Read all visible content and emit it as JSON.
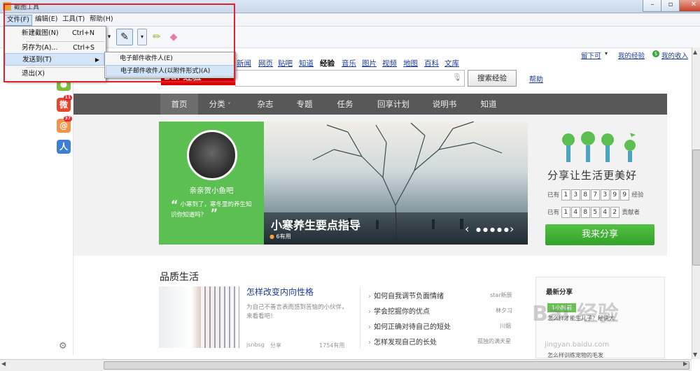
{
  "window": {
    "title": "截图工具"
  },
  "menubar": {
    "file": "文件(F)",
    "edit": "编辑(E)",
    "tools": "工具(T)",
    "help": "帮助(H)"
  },
  "file_menu": {
    "new_capture": "新建截图(N)",
    "new_capture_shortcut": "Ctrl+N",
    "save_as": "另存为(A)...",
    "save_as_shortcut": "Ctrl+S",
    "send_to": "发送到(T)",
    "exit": "退出(X)"
  },
  "send_to_menu": {
    "email_recipient": "电子邮件收件人(E)",
    "email_attachment": "电子邮件收件人(以附件形式)(A)"
  },
  "browser": {
    "top_nav": [
      "新闻",
      "网页",
      "贴吧",
      "知道",
      "经验",
      "音乐",
      "图片",
      "视频",
      "地图",
      "百科",
      "文库"
    ],
    "active_nav": "经验",
    "logo_text": "Bai 经验",
    "search_button": "搜索经验",
    "help_link": "帮助",
    "user_link": "留下可",
    "my_experience": "我的经验",
    "my_favorites": "我的收入",
    "side_badges": {
      "weibo": "11",
      "other": "37"
    },
    "categories": [
      "首页",
      "分类",
      "杂志",
      "专题",
      "任务",
      "回享计划",
      "说明书",
      "知道"
    ],
    "category_dropdown": "˅",
    "hero": {
      "user_name": "亲亲贺小鱼吧",
      "quote": "小寒到了，寒冬里的养生知识你知道吗？",
      "title": "小寒养生要点指导",
      "likes": "6有用"
    },
    "share_panel": {
      "slogan": "分享让生活更美好",
      "row1_prefix": "已有",
      "row1_digits": [
        "1",
        "3",
        "8",
        "7",
        "3",
        "9",
        "9"
      ],
      "row1_suffix": "经验",
      "row2_prefix": "已有",
      "row2_digits": [
        "1",
        "4",
        "8",
        "5",
        "4",
        "2"
      ],
      "row2_suffix": "贡献者",
      "button": "我来分享"
    },
    "quality": {
      "section_title": "品质生活",
      "headline": "怎样改变内向性格",
      "description": "为自己不善言表而感到苦恼的小伙伴，来看看吧！",
      "author": "jsnbsg",
      "share_label": "分享",
      "uses": "1754有用",
      "list": [
        {
          "title": "如何自我调节负面情绪",
          "author": "star新辰"
        },
        {
          "title": "学会挖掘你的优点",
          "author": "林夕习"
        },
        {
          "title": "如何正确对待自己的短处",
          "author": "川烟"
        },
        {
          "title": "怎样发现自己的长处",
          "author": "孤独的满天星"
        }
      ]
    },
    "latest": {
      "title": "最新分享",
      "time": "1小时前",
      "item1": "怎么样才能生儿子？秘诀大",
      "item2": "怎么样训练宠物的毛发"
    },
    "watermark": "Bai 经验",
    "watermark_url": "jingyan.baidu.com"
  }
}
